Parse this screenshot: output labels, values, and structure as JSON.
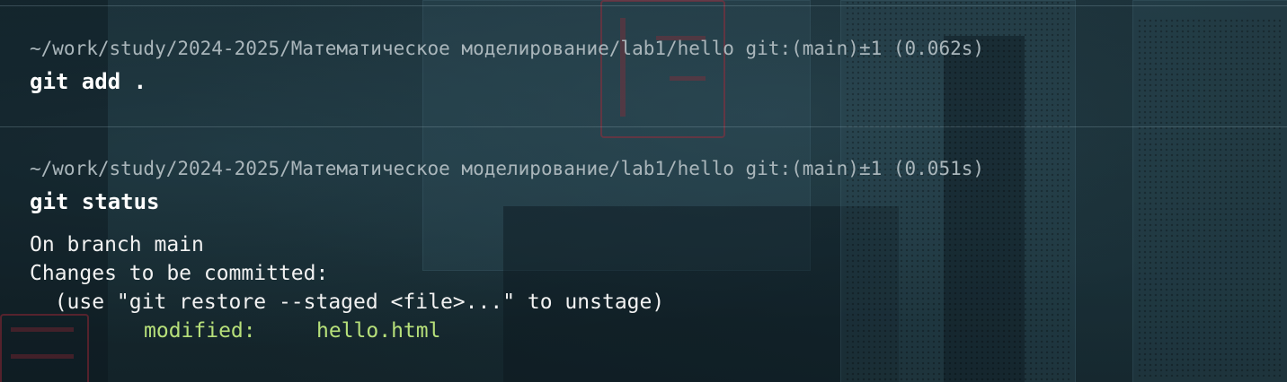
{
  "terminal": {
    "blocks": [
      {
        "prompt": "~/work/study/2024-2025/Математическое моделирование/lab1/hello git:(main)±1 (0.062s)",
        "command": "git add ."
      },
      {
        "prompt": "~/work/study/2024-2025/Математическое моделирование/lab1/hello git:(main)±1 (0.051s)",
        "command": "git status",
        "output": {
          "line1": "On branch main",
          "line2": "Changes to be committed:",
          "line3": "  (use \"git restore --staged <file>...\" to unstage)",
          "modified_label": "modified:",
          "modified_file": "hello.html"
        }
      }
    ]
  },
  "colors": {
    "background": "#15282f",
    "prompt_text": "#aab6bb",
    "command_text": "#ffffff",
    "output_text": "#f2f2f2",
    "staged_green": "#b7e07a"
  }
}
